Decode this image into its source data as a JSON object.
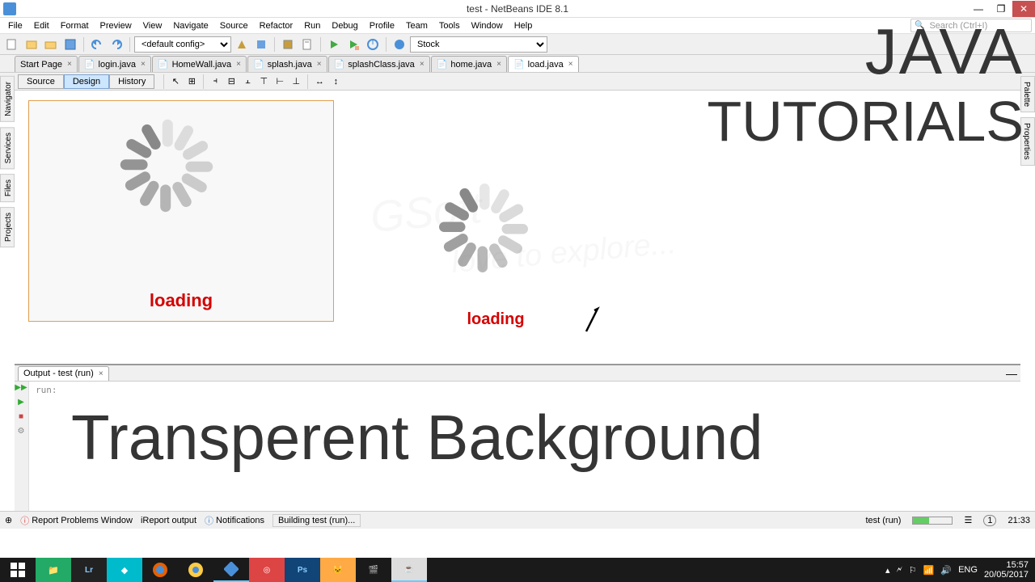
{
  "window": {
    "title": "test - NetBeans IDE 8.1"
  },
  "menu": [
    "File",
    "Edit",
    "Format",
    "Preview",
    "View",
    "Navigate",
    "Source",
    "Refactor",
    "Run",
    "Debug",
    "Profile",
    "Team",
    "Tools",
    "Window",
    "Help"
  ],
  "search_placeholder": "Search (Ctrl+I)",
  "config_default": "<default config>",
  "stock_label": "Stock",
  "tabs": [
    {
      "label": "Start Page",
      "icon": "page"
    },
    {
      "label": "login.java",
      "icon": "java"
    },
    {
      "label": "HomeWall.java",
      "icon": "java"
    },
    {
      "label": "splash.java",
      "icon": "java"
    },
    {
      "label": "splashClass.java",
      "icon": "java"
    },
    {
      "label": "home.java",
      "icon": "java"
    },
    {
      "label": "load.java",
      "icon": "java",
      "active": true
    }
  ],
  "subtabs": {
    "source": "Source",
    "design": "Design",
    "history": "History"
  },
  "side_left": [
    "Navigator",
    "Services",
    "Files",
    "Projects"
  ],
  "side_right": [
    "Palette",
    "Properties"
  ],
  "designer": {
    "loading_label": "loading"
  },
  "popup": {
    "loading_label": "loading"
  },
  "overlay": {
    "java": "JAVA",
    "tutorials": "TUTORIALS",
    "transparent": "Transperent Background"
  },
  "watermark": {
    "brand": "GSoft",
    "tagline": "love to explore..."
  },
  "output": {
    "title": "Output - test (run)",
    "text": "run:"
  },
  "status": {
    "report": "Report Problems Window",
    "ireport": "iReport output",
    "notifications": "Notifications",
    "building": "Building test (run)...",
    "task": "test (run)",
    "col": "21:33",
    "badge": "1"
  },
  "tray": {
    "lang": "ENG",
    "time": "15:57",
    "date": "20/05/2017"
  }
}
